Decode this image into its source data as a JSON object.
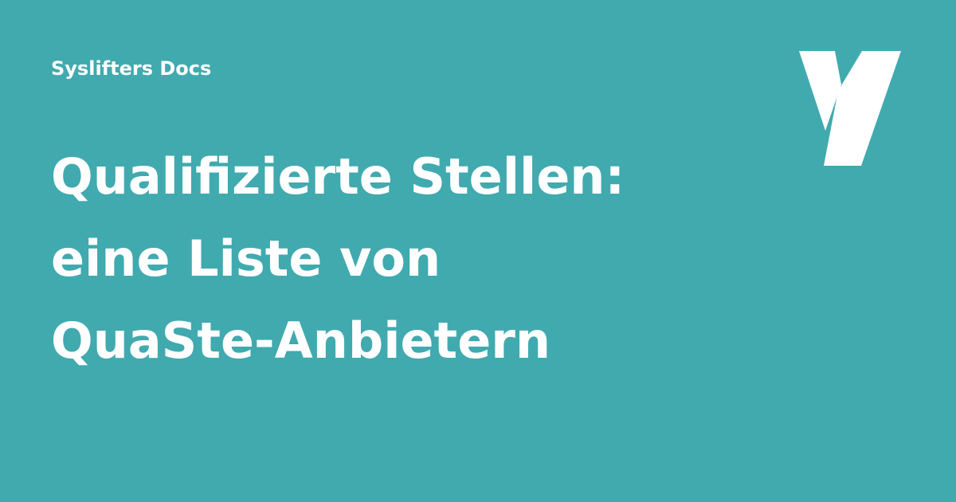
{
  "header": {
    "site_name": "Syslifters Docs"
  },
  "main": {
    "title_lines": [
      "Qualifizierte Stellen:",
      "eine Liste von",
      "QuaSte-Anbietern"
    ]
  },
  "logo": {
    "icon": "syslifters-y-logo-icon"
  },
  "colors": {
    "background": "#40aaaf",
    "text": "#ffffff"
  }
}
